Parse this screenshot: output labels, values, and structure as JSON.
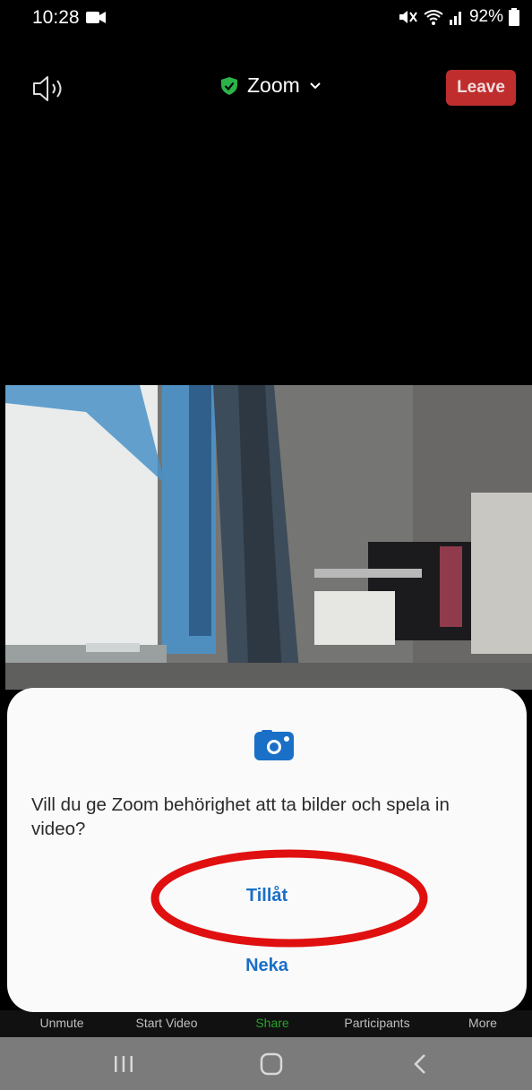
{
  "status_bar": {
    "time": "10:28",
    "battery_percent": "92%",
    "icons": [
      "video-recording-icon",
      "mute-icon",
      "wifi-icon",
      "signal-icon",
      "battery-icon"
    ]
  },
  "header": {
    "meeting_name": "Zoom",
    "leave_label": "Leave",
    "icons": [
      "speaker-icon",
      "shield-check-icon",
      "chevron-down-icon"
    ]
  },
  "toolbar": {
    "items": [
      {
        "label": "Unmute"
      },
      {
        "label": "Start Video"
      },
      {
        "label": "Share"
      },
      {
        "label": "Participants"
      },
      {
        "label": "More"
      }
    ]
  },
  "permission_dialog": {
    "question": "Vill du ge Zoom behörighet att ta bilder och spela in video?",
    "allow_label": "Tillåt",
    "deny_label": "Neka",
    "icon": "camera-icon"
  },
  "nav_bar": {
    "icons": [
      "recent-apps-icon",
      "home-icon",
      "back-icon"
    ]
  },
  "colors": {
    "leave_red": "#bf2d2d",
    "share_green": "#29a329",
    "dialog_blue": "#1a6fc6",
    "annotation_red": "#e01010",
    "shield_green": "#2bb34a"
  }
}
